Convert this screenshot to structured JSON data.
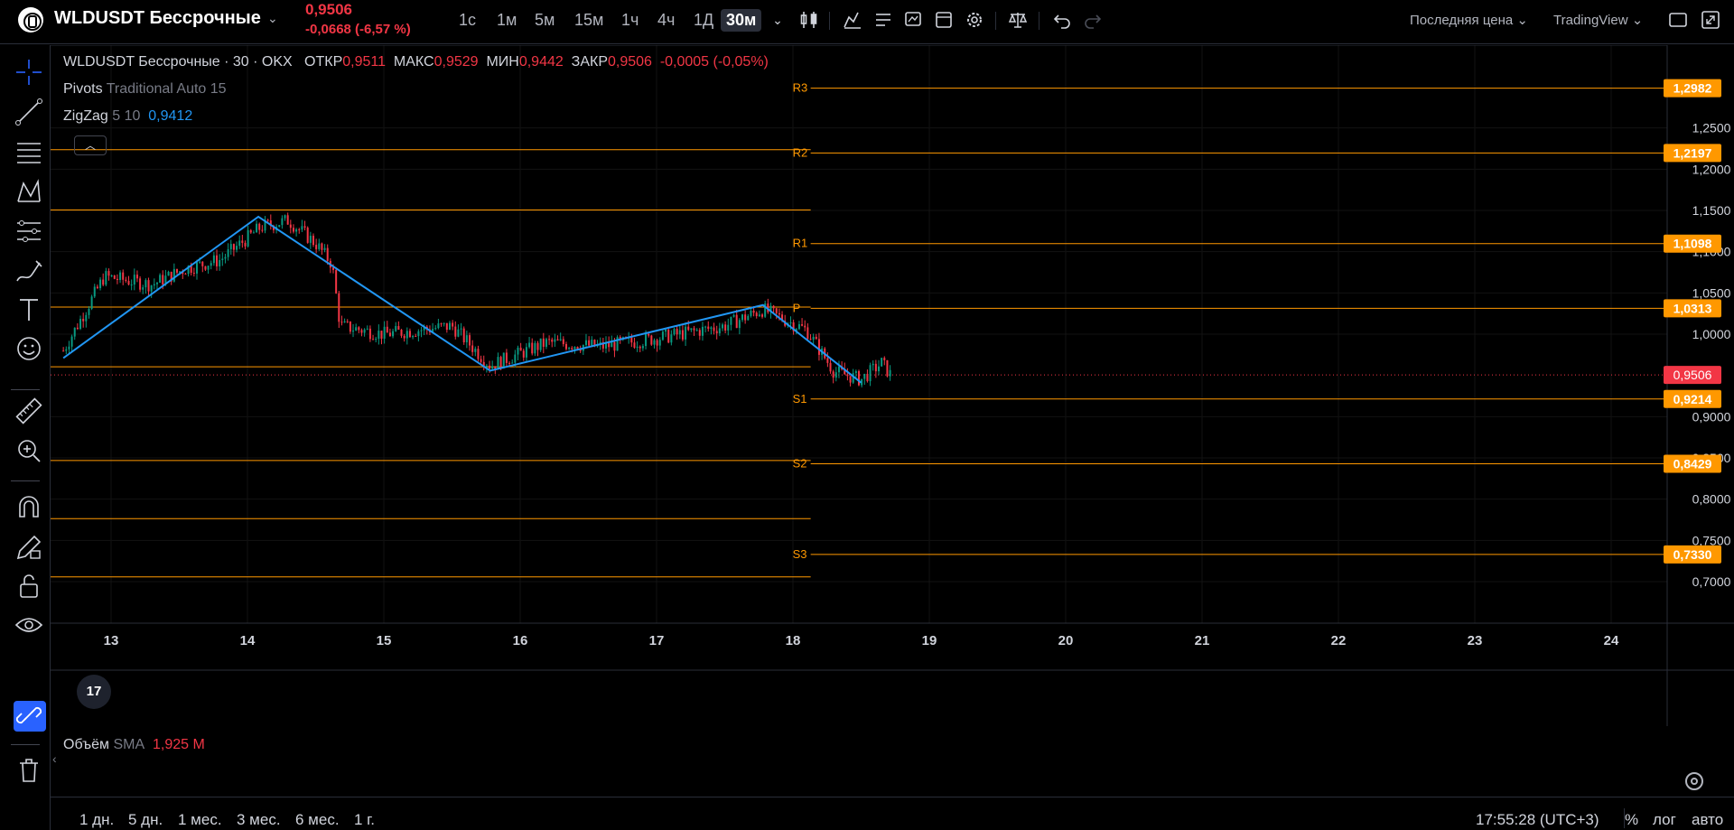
{
  "symbol": {
    "title": "WLDUSDT Бессрочные",
    "price": "0,9506",
    "change": "-0,0668 (-6,57 %)"
  },
  "timeframes": [
    "1с",
    "1м",
    "5м",
    "15м",
    "1ч",
    "4ч",
    "1Д",
    "30м"
  ],
  "active_timeframe": "30м",
  "toolbar": {
    "price_source": "Последняя цена",
    "platform": "TradingView"
  },
  "legend": {
    "title": "WLDUSDT Бессрочные · 30 · OKX",
    "o_label": "ОТКР",
    "o_value": "0,9511",
    "h_label": "МАКС",
    "h_value": "0,9529",
    "l_label": "МИН",
    "l_value": "0,9442",
    "c_label": "ЗАКР",
    "c_value": "0,9506",
    "chg_value": "-0,0005 (-0,05%)"
  },
  "indicators": {
    "pivots_name": "Pivots",
    "pivots_params": "Traditional Auto 15",
    "zigzag_name": "ZigZag",
    "zigzag_params": "5 10",
    "zigzag_value": "0,9412"
  },
  "volume": {
    "name": "Объём",
    "params": "SMA",
    "value": "1,925 M"
  },
  "tv_badge": "17",
  "ranges": [
    "1 дн.",
    "5 дн.",
    "1 мес.",
    "3 мес.",
    "6 мес.",
    "1 г."
  ],
  "clock": "17:55:28 (UTC+3)",
  "scale_options": {
    "percent": "%",
    "log": "лог",
    "auto": "авто"
  },
  "colors": {
    "background": "#000000",
    "up": "#089981",
    "down": "#f23645",
    "pivot": "#ff9800",
    "zigzag": "#2196f3",
    "accent": "#2962ff"
  },
  "chart_data": {
    "type": "candlestick",
    "x_tick_labels": [
      "13",
      "14",
      "15",
      "16",
      "17",
      "18",
      "19",
      "20",
      "21",
      "22",
      "23",
      "24"
    ],
    "y_tick_labels": [
      "1,2500",
      "1,2000",
      "1,1500",
      "1,1000",
      "1,0500",
      "1,0000",
      "0,9000",
      "0,8500",
      "0,8000",
      "0,7500",
      "0,7000"
    ],
    "y_ticks": [
      1.25,
      1.2,
      1.15,
      1.1,
      1.05,
      1.0,
      0.9,
      0.85,
      0.8,
      0.75,
      0.7
    ],
    "ylim": [
      0.665,
      1.335
    ],
    "current_price": {
      "value": 0.9506,
      "label": "0,9506"
    },
    "pivots_current": [
      {
        "name": "R3",
        "value": 1.2982,
        "label": "1,2982"
      },
      {
        "name": "R2",
        "value": 1.2197,
        "label": "1,2197"
      },
      {
        "name": "R1",
        "value": 1.1098,
        "label": "1,1098"
      },
      {
        "name": "P",
        "value": 1.0313,
        "label": "1,0313"
      },
      {
        "name": "S1",
        "value": 0.9214,
        "label": "0,9214"
      },
      {
        "name": "S2",
        "value": 0.8429,
        "label": "0,8429"
      },
      {
        "name": "S3",
        "value": 0.733,
        "label": "0,7330"
      }
    ],
    "pivots_previous": [
      1.2236,
      1.1505,
      1.0329,
      0.9605,
      0.8469,
      0.7764,
      0.7058
    ],
    "zigzag": [
      {
        "day": 12.65,
        "value": 0.9711
      },
      {
        "day": 14.08,
        "value": 1.1424
      },
      {
        "day": 15.78,
        "value": 0.9557
      },
      {
        "day": 17.78,
        "value": 1.0353
      },
      {
        "day": 18.5,
        "value": 0.9412
      }
    ],
    "price_anchors": [
      {
        "day": 12.65,
        "value": 0.98
      },
      {
        "day": 12.95,
        "value": 1.07
      },
      {
        "day": 13.3,
        "value": 1.06
      },
      {
        "day": 13.55,
        "value": 1.08
      },
      {
        "day": 13.8,
        "value": 1.09
      },
      {
        "day": 14.1,
        "value": 1.13
      },
      {
        "day": 14.3,
        "value": 1.138
      },
      {
        "day": 14.5,
        "value": 1.11
      },
      {
        "day": 14.62,
        "value": 1.085
      },
      {
        "day": 14.68,
        "value": 1.01
      },
      {
        "day": 15.0,
        "value": 1.0
      },
      {
        "day": 15.5,
        "value": 1.01
      },
      {
        "day": 15.78,
        "value": 0.962
      },
      {
        "day": 16.2,
        "value": 0.99
      },
      {
        "day": 16.6,
        "value": 0.985
      },
      {
        "day": 17.0,
        "value": 0.995
      },
      {
        "day": 17.5,
        "value": 1.01
      },
      {
        "day": 17.78,
        "value": 1.03
      },
      {
        "day": 18.1,
        "value": 1.005
      },
      {
        "day": 18.3,
        "value": 0.955
      },
      {
        "day": 18.5,
        "value": 0.945
      },
      {
        "day": 18.65,
        "value": 0.965
      },
      {
        "day": 18.72,
        "value": 0.95
      }
    ]
  }
}
